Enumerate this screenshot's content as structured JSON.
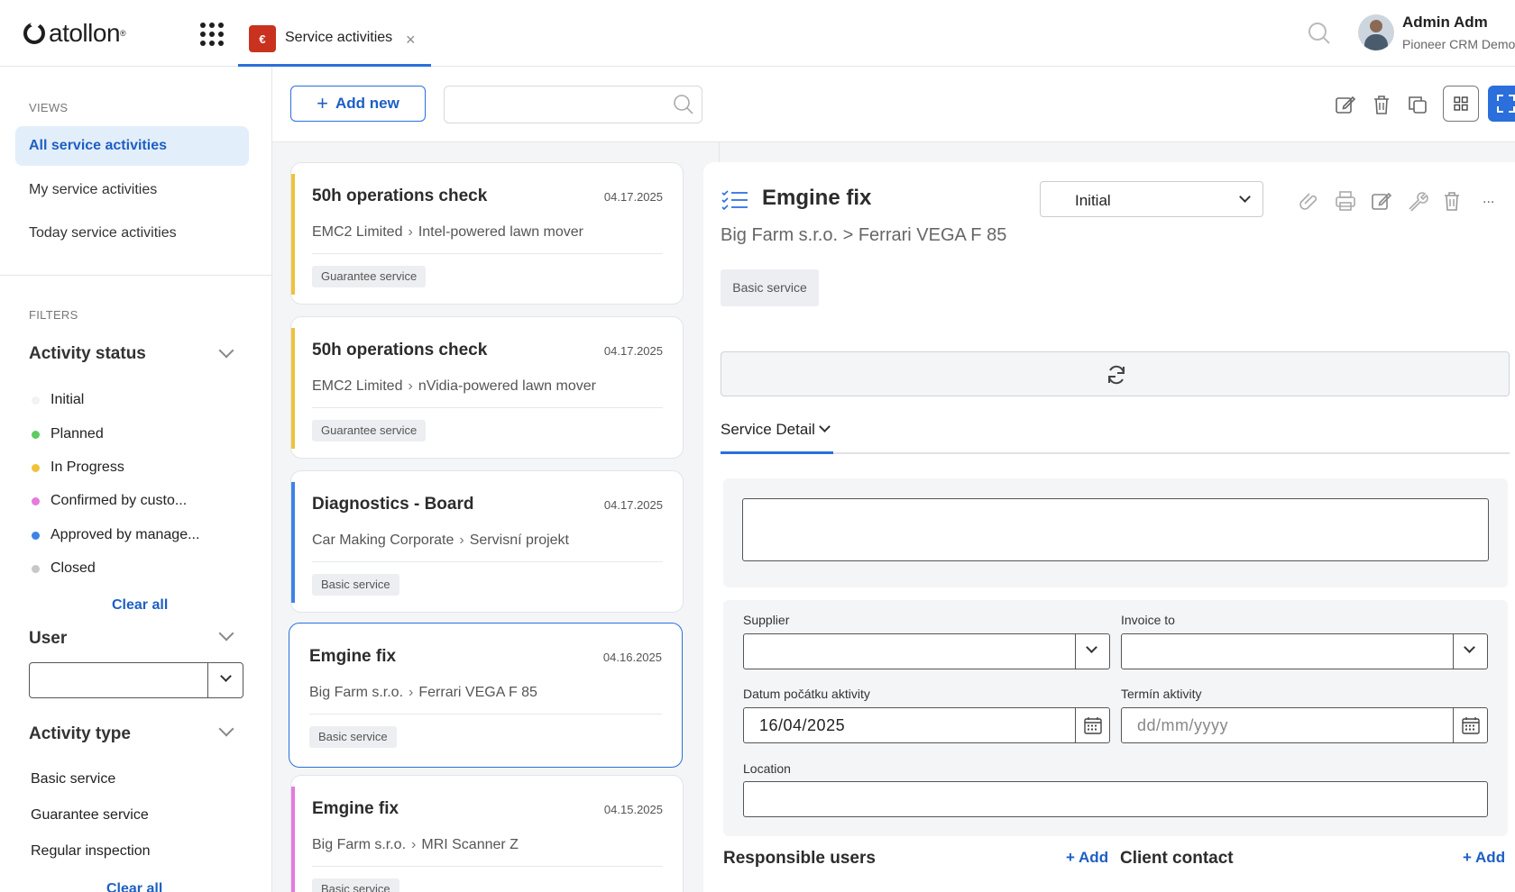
{
  "app": {
    "logo_text": "atollon",
    "tab_label": "Service activities",
    "tab_icon_text": "€",
    "user_name": "Admin Adm",
    "user_org": "Pioneer CRM Demo"
  },
  "sidebar": {
    "views_label": "VIEWS",
    "views": [
      {
        "label": "All service activities"
      },
      {
        "label": "My service activities"
      },
      {
        "label": "Today service activities"
      }
    ],
    "filters_label": "FILTERS",
    "activity_status": {
      "title": "Activity status",
      "items": [
        {
          "label": "Initial",
          "color": "#f2f2f2"
        },
        {
          "label": "Planned",
          "color": "#5ecb5e"
        },
        {
          "label": "In Progress",
          "color": "#f0c23a"
        },
        {
          "label": "Confirmed by custo...",
          "color": "#e57ae0"
        },
        {
          "label": "Approved by manage...",
          "color": "#3c84e6"
        },
        {
          "label": "Closed",
          "color": "#c8c8c8"
        }
      ],
      "clear_all": "Clear all"
    },
    "user_filter": {
      "title": "User"
    },
    "activity_type": {
      "title": "Activity type",
      "items": [
        {
          "label": "Basic service"
        },
        {
          "label": "Guarantee service"
        },
        {
          "label": "Regular inspection"
        }
      ],
      "clear_all": "Clear all"
    }
  },
  "list": {
    "add_new": "Add new",
    "search_placeholder": "",
    "cards": [
      {
        "title": "50h operations check",
        "date": "04.17.2025",
        "client": "EMC2 Limited",
        "object": "Intel-powered lawn mover",
        "tag": "Guarantee service",
        "color": "#f0c23a"
      },
      {
        "title": "50h operations check",
        "date": "04.17.2025",
        "client": "EMC2 Limited",
        "object": "nVidia-powered lawn mover",
        "tag": "Guarantee service",
        "color": "#f0c23a"
      },
      {
        "title": "Diagnostics - Board",
        "date": "04.17.2025",
        "client": "Car Making Corporate",
        "object": "Servisní projekt",
        "tag": "Basic service",
        "color": "#3c84e6"
      },
      {
        "title": "Emgine fix",
        "date": "04.16.2025",
        "client": "Big Farm s.r.o.",
        "object": "Ferrari VEGA F 85",
        "tag": "Basic service",
        "color": "none"
      },
      {
        "title": "Emgine fix",
        "date": "04.15.2025",
        "client": "Big Farm s.r.o.",
        "object": "MRI Scanner Z",
        "tag": "Basic service",
        "color": "#e57ae0"
      }
    ]
  },
  "detail": {
    "title": "Emgine fix",
    "path": "Big Farm s.r.o. > Ferrari VEGA F 85",
    "status": "Initial",
    "more": "...",
    "tag": "Basic service",
    "tab_label": "Service Detail",
    "fields": {
      "supplier_label": "Supplier",
      "invoice_label": "Invoice to",
      "start_label": "Datum počátku aktivity",
      "start_value": "16/04/2025",
      "deadline_label": "Termín aktivity",
      "deadline_placeholder": "dd/mm/yyyy",
      "location_label": "Location"
    },
    "responsible_users": "Responsible users",
    "client_contact": "Client contact",
    "add_label": "Add"
  }
}
